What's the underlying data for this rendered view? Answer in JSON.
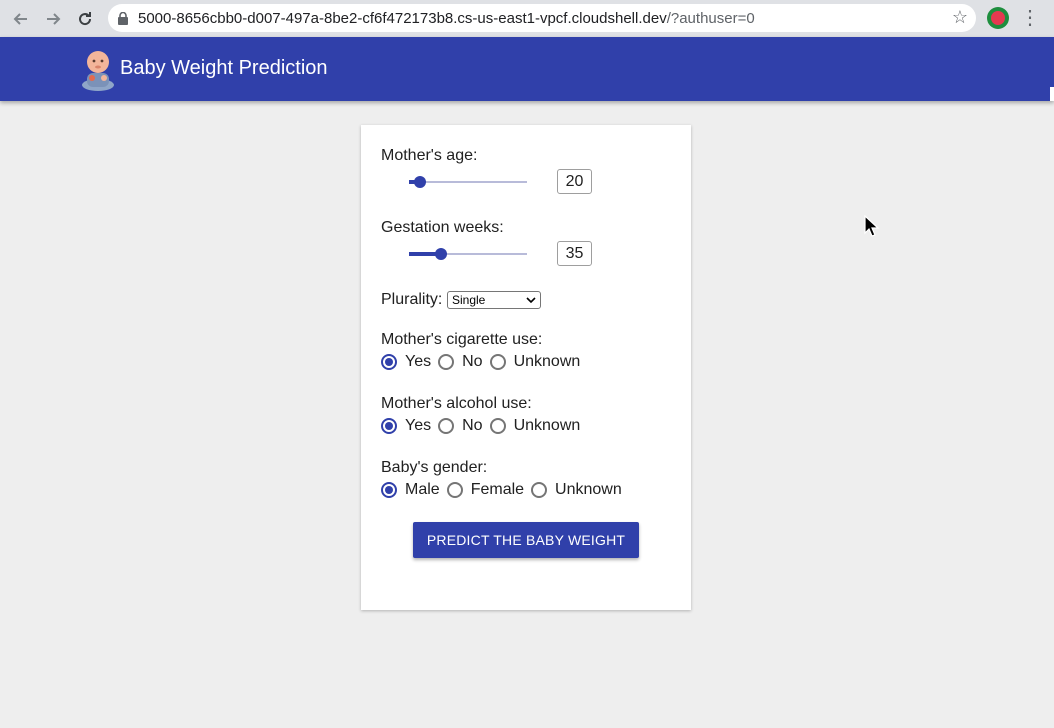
{
  "browser": {
    "url_host": "5000-8656cbb0-d007-497a-8be2-cf6f472173b8.cs-us-east1-vpcf.cloudshell.dev",
    "url_path": "/?authuser=0"
  },
  "app": {
    "title": "Baby Weight Prediction",
    "accent_color": "#3040aa"
  },
  "form": {
    "mother_age": {
      "label": "Mother's age:",
      "value": "20",
      "slider_fraction": 0.09
    },
    "gestation": {
      "label": "Gestation weeks:",
      "value": "35",
      "slider_fraction": 0.27
    },
    "plurality": {
      "label": "Plurality:",
      "selected": "Single"
    },
    "cigarette": {
      "label": "Mother's cigarette use:",
      "options": [
        "Yes",
        "No",
        "Unknown"
      ],
      "selected": "Yes"
    },
    "alcohol": {
      "label": "Mother's alcohol use:",
      "options": [
        "Yes",
        "No",
        "Unknown"
      ],
      "selected": "Yes"
    },
    "gender": {
      "label": "Baby's gender:",
      "options": [
        "Male",
        "Female",
        "Unknown"
      ],
      "selected": "Male"
    },
    "predict_label": "PREDICT THE BABY WEIGHT"
  }
}
